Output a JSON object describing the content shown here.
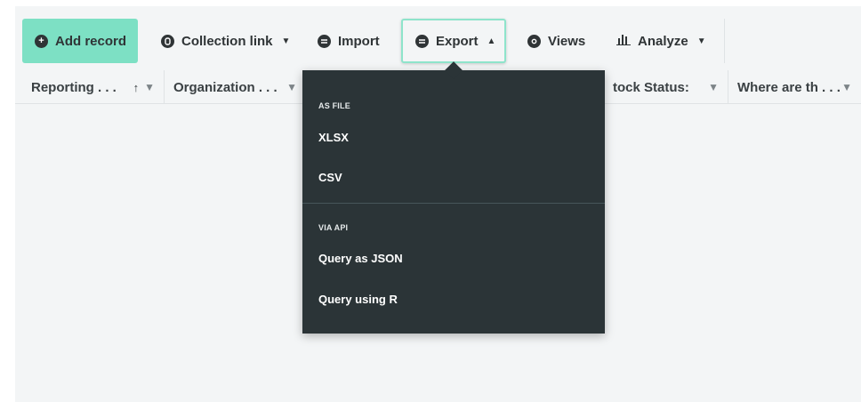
{
  "toolbar": {
    "add_record": "Add record",
    "collection_link": "Collection link",
    "import": "Import",
    "export": "Export",
    "views": "Views",
    "analyze": "Analyze"
  },
  "grid": {
    "columns": [
      {
        "label": "Reporting . . .",
        "sorted": "ascending"
      },
      {
        "label": "Organization . . ."
      },
      {
        "label": "tock Status:"
      },
      {
        "label": "Where are th . . ."
      }
    ]
  },
  "export_menu": {
    "sections": [
      {
        "title": "AS FILE",
        "items": [
          "XLSX",
          "CSV"
        ]
      },
      {
        "title": "VIA API",
        "items": [
          "Query as JSON",
          "Query using R"
        ]
      }
    ]
  },
  "icons": {
    "add": "plus-circle-icon",
    "collection": "link-circle-icon",
    "import": "import-circle-icon",
    "export": "export-circle-icon",
    "views": "eye-icon",
    "analyze": "bar-chart-icon",
    "sort": "arrow-up-icon",
    "filter": "funnel-icon"
  },
  "colors": {
    "primary": "#7de0c4",
    "menu_bg": "#2b3437",
    "canvas_bg": "#f3f5f6"
  }
}
